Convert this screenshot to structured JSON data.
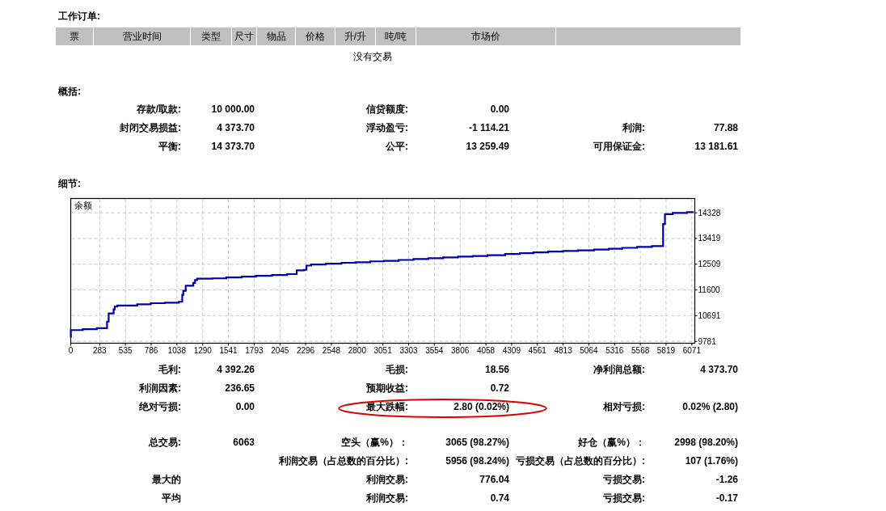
{
  "working_orders": {
    "title": "工作订单:",
    "columns": [
      "票",
      "营业时间",
      "类型",
      "尺寸",
      "物品",
      "价格",
      "升/升",
      "吨/吨",
      "市场价"
    ],
    "empty_message": "没有交易"
  },
  "summary": {
    "title": "概括:",
    "rows": [
      {
        "left": {
          "label": "存款/取款:",
          "value": "10 000.00"
        },
        "middle": {
          "label": "信贷额度:",
          "value": "0.00"
        }
      },
      {
        "left": {
          "label": "封闭交易损益:",
          "value": "4 373.70"
        },
        "middle": {
          "label": "浮动盈亏:",
          "value": "-1 114.21"
        },
        "right": {
          "label": "利润:",
          "value": "77.88"
        }
      },
      {
        "left": {
          "label": "平衡:",
          "value": "14 373.70"
        },
        "middle": {
          "label": "公平:",
          "value": "13 259.49"
        },
        "right": {
          "label": "可用保证金:",
          "value": "13 181.61"
        }
      }
    ]
  },
  "details": {
    "title": "细节:",
    "chart_data": {
      "type": "line",
      "grid": true,
      "x": [
        0,
        1,
        118,
        118,
        255,
        255,
        355,
        355,
        371,
        419,
        430,
        455,
        650,
        782,
        919,
        1056,
        1090,
        1100,
        1124,
        1198,
        1215,
        1235,
        1383,
        1520,
        1672,
        1810,
        1968,
        2115,
        2209,
        2209,
        2280,
        2304,
        2349,
        2494,
        2647,
        2784,
        2928,
        3060,
        3205,
        3350,
        3495,
        3640,
        3785,
        3930,
        4074,
        4246,
        4390,
        4522,
        4667,
        4812,
        4957,
        5115,
        5260,
        5391,
        5536,
        5681,
        5787,
        5790,
        5808,
        5884,
        6024,
        6090
      ],
      "series": [
        {
          "name": "余额",
          "color": "#0000aa",
          "values": [
            9940,
            10180,
            10180,
            10210,
            10210,
            10250,
            10250,
            10480,
            10770,
            10910,
            11010,
            11050,
            11090,
            11130,
            11150,
            11180,
            11430,
            11570,
            11750,
            11850,
            11950,
            12000,
            12010,
            12040,
            12070,
            12100,
            12130,
            12160,
            12160,
            12290,
            12310,
            12460,
            12500,
            12530,
            12560,
            12580,
            12610,
            12630,
            12660,
            12690,
            12720,
            12750,
            12780,
            12800,
            12830,
            12870,
            12900,
            12930,
            12960,
            12980,
            13000,
            13030,
            13060,
            13090,
            13120,
            13150,
            13150,
            13930,
            14280,
            14320,
            14350,
            14350
          ]
        }
      ],
      "xlim": [
        0,
        6100
      ],
      "ylim": [
        9715,
        14834
      ],
      "xticks": [
        0,
        283,
        535,
        786,
        1038,
        1290,
        1541,
        1793,
        2045,
        2296,
        2548,
        2800,
        3051,
        3303,
        3554,
        3806,
        4058,
        4309,
        4561,
        4813,
        5064,
        5316,
        5568,
        5819,
        6071
      ],
      "yticks": [
        9781,
        10691,
        11600,
        12509,
        13419,
        14328
      ]
    },
    "groups": [
      {
        "rows": [
          {
            "left": {
              "label": "毛利:",
              "value": "4 392.26",
              "circled": false
            },
            "middle": {
              "label": "毛损:",
              "value": "18.56",
              "circled": false
            },
            "right": {
              "label": "净利润总额:",
              "value": "4 373.70",
              "circled": false
            }
          },
          {
            "left": {
              "label": "利润因素:",
              "value": "236.65",
              "circled": false
            },
            "middle": {
              "label": "预期收益:",
              "value": "0.72",
              "circled": false
            }
          },
          {
            "left": {
              "label": "绝对亏损:",
              "value": "0.00",
              "circled": false
            },
            "middle": {
              "label": "最大跌幅:",
              "value": "2.80 (0.02%)",
              "circled": true
            },
            "right": {
              "label": "相对亏损:",
              "value": "0.02% (2.80)",
              "circled": false
            }
          }
        ]
      },
      {
        "rows": [
          {
            "left": {
              "label": "总交易:",
              "value": "6063",
              "circled": false
            },
            "middle": {
              "label": "空头（赢%）：",
              "value": "3065 (98.27%)",
              "circled": false
            },
            "right": {
              "label": "好仓（赢%）：",
              "value": "2998 (98.20%)",
              "circled": false
            }
          },
          {
            "middle": {
              "label": "利润交易（占总数的百分比）:",
              "value": "5956 (98.24%)",
              "circled": false
            },
            "right": {
              "label": "亏损交易（占总数的百分比）:",
              "value": "107 (1.76%)",
              "circled": false
            }
          },
          {
            "left": {
              "label": "最大的",
              "circled": false
            },
            "middle": {
              "label": "利润交易:",
              "value": "776.04",
              "circled": false
            },
            "right": {
              "label": "亏损交易:",
              "value": "-1.26",
              "circled": false
            }
          },
          {
            "left": {
              "label": "平均",
              "circled": false
            },
            "middle": {
              "label": "利润交易:",
              "value": "0.74",
              "circled": false
            },
            "right": {
              "label": "亏损交易:",
              "value": "-0.17",
              "circled": false
            }
          }
        ]
      }
    ]
  }
}
